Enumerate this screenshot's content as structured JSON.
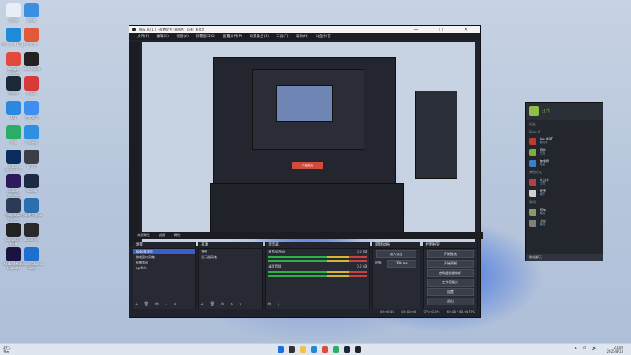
{
  "desktop_icons": [
    {
      "label": "回收站",
      "color": "#e8eef5"
    },
    {
      "label": "此电脑",
      "color": "#3b8fe0"
    },
    {
      "label": "Microsoft Edge",
      "color": "#1f8ad8"
    },
    {
      "label": "Xmind",
      "color": "#e05a3a"
    },
    {
      "label": "Google Chrome",
      "color": "#e24b3b"
    },
    {
      "label": "OBS Studio",
      "color": "#222"
    },
    {
      "label": "Steam",
      "color": "#1b2838"
    },
    {
      "label": "网易云",
      "color": "#d83a3a"
    },
    {
      "label": "QQ",
      "color": "#2a88e0"
    },
    {
      "label": "百度网盘",
      "color": "#3f8ff2"
    },
    {
      "label": "微信",
      "color": "#2aae67"
    },
    {
      "label": "小智桌面",
      "color": "#2f8fe0"
    },
    {
      "label": "Adobe Photoshop",
      "color": "#0a2d5e"
    },
    {
      "label": "Ghost",
      "color": "#3a3e46"
    },
    {
      "label": "Adobe Premiere",
      "color": "#2c1a5a"
    },
    {
      "label": "ToDesk",
      "color": "#1d2a44"
    },
    {
      "label": "Wallpaper Engine",
      "color": "#2b3a55"
    },
    {
      "label": "Cheat Engine",
      "color": "#2a6fb0"
    },
    {
      "label": "Logitech G HUB",
      "color": "#222"
    },
    {
      "label": "SteamVR",
      "color": "#2a2a2a"
    },
    {
      "label": "Adobe Media Encoder",
      "color": "#1a1240"
    },
    {
      "label": "Visual Studio Code",
      "color": "#1f6fcf"
    }
  ],
  "obs": {
    "title": "OBS 30.1.2 - 配置文件: 未命名 - 场景: 未命名",
    "menu": [
      "文件(F)",
      "编辑(E)",
      "视图(V)",
      "停靠窗口(D)",
      "配置文件(P)",
      "场景集合(S)",
      "工具(T)",
      "帮助(H)",
      "斗鱼/抖音"
    ],
    "preview_button": "开始推流",
    "dock_tabs": [
      "来源属性",
      "滤镜",
      "属性"
    ],
    "scenes": {
      "header": "场景",
      "items": [
        "YoBo推荐图",
        "游戏窗口采集",
        "直播频道",
        "pptfish"
      ]
    },
    "sources": {
      "header": "来源",
      "items": [
        "YPA",
        "显示器采集"
      ]
    },
    "mixer": {
      "header": "混音器",
      "channels": [
        {
          "name": "麦克风/Aux",
          "db": "0.0 dB"
        },
        {
          "name": "桌面音频",
          "db": "0.0 dB"
        }
      ]
    },
    "transitions": {
      "header": "转场动画",
      "type": "淡入淡出",
      "duration_label": "时长",
      "duration": "300 ms"
    },
    "controls": {
      "header": "控制按钮",
      "buttons": [
        "开始推流",
        "开始录制",
        "启动虚拟摄像机",
        "工作室模式",
        "设置",
        "退出"
      ]
    },
    "status": {
      "stream_time": "00:00:00",
      "rec_time": "00:00:00",
      "cpu": "CPU: 0.8%",
      "fps": "60.00 / 60.00 FPS"
    }
  },
  "chat": {
    "username": "打六",
    "search_label": "好友",
    "game_section": "Dota 2",
    "friends": [
      {
        "name": "Yue DOT",
        "status": "游戏中",
        "color": "#c0392b"
      },
      {
        "name": "绵羊",
        "status": "在线",
        "color": "#7fae3e"
      },
      {
        "name": "咖啡狮",
        "status": "在线",
        "color": "#3a7fc9"
      }
    ],
    "online_section": "其他好友",
    "online": [
      {
        "name": "大山羊",
        "status": "在线",
        "color": "#b54040"
      },
      {
        "name": "无序",
        "status": "离开",
        "color": "#d0d0d0"
      }
    ],
    "offline_section": "离线",
    "offline": [
      {
        "name": "阿布",
        "status": "离线",
        "color": "#8c9a6a"
      },
      {
        "name": "拉克",
        "status": "离线",
        "color": "#7f7f7f"
      }
    ],
    "footer": "群组聊天"
  },
  "taskbar": {
    "weather_temp": "29°C",
    "weather_desc": "多云",
    "time": "21:08",
    "date": "2025/8/13",
    "icons": [
      {
        "name": "start",
        "color": "#1e6fe0"
      },
      {
        "name": "search",
        "color": "#333"
      },
      {
        "name": "file-explorer",
        "color": "#f2c14e"
      },
      {
        "name": "edge",
        "color": "#1f8ad8"
      },
      {
        "name": "chrome",
        "color": "#e24b3b"
      },
      {
        "name": "wechat",
        "color": "#2aae67"
      },
      {
        "name": "steam",
        "color": "#1b2838"
      },
      {
        "name": "obs",
        "color": "#222"
      }
    ]
  }
}
